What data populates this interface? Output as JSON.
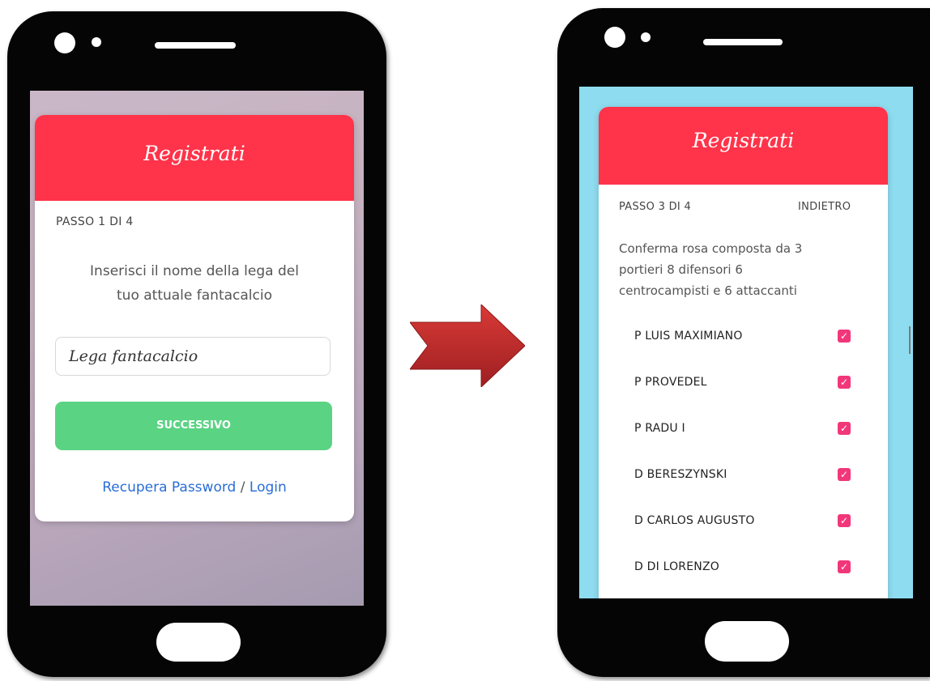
{
  "left_phone": {
    "header_title": "Registrati",
    "step_label": "PASSO 1 DI 4",
    "instruction_line1": "Inserisci il nome della lega del",
    "instruction_line2": "tuo attuale fantacalcio",
    "league_input_placeholder": "Lega fantacalcio",
    "next_button_label": "SUCCESSIVO",
    "recover_password_link": "Recupera Password",
    "separator": "/",
    "login_link": "Login"
  },
  "right_phone": {
    "header_title": "Registrati",
    "step_label": "PASSO 3 DI 4",
    "back_link": "INDIETRO",
    "instruction_line1": "Conferma rosa composta da 3",
    "instruction_line2": "portieri 8 difensori 6",
    "instruction_line3": "centrocampisti e 6 attaccanti",
    "players": [
      {
        "name": "P LUIS MAXIMIANO",
        "checked": true
      },
      {
        "name": "P PROVEDEL",
        "checked": true
      },
      {
        "name": "P RADU I",
        "checked": true
      },
      {
        "name": "D BERESZYNSKI",
        "checked": true
      },
      {
        "name": "D CARLOS AUGUSTO",
        "checked": true
      },
      {
        "name": "D DI LORENZO",
        "checked": true
      }
    ]
  },
  "icons": {
    "arrow": "right-arrow-icon",
    "checkbox": "checkbox-checked-icon"
  },
  "colors": {
    "header_red": "#ff3349",
    "button_green": "#5ad383",
    "link_blue": "#2a6dd6",
    "checkbox_pink": "#f1377a",
    "right_screen_bg": "#8edcef",
    "arrow_red": "#c0282b"
  }
}
